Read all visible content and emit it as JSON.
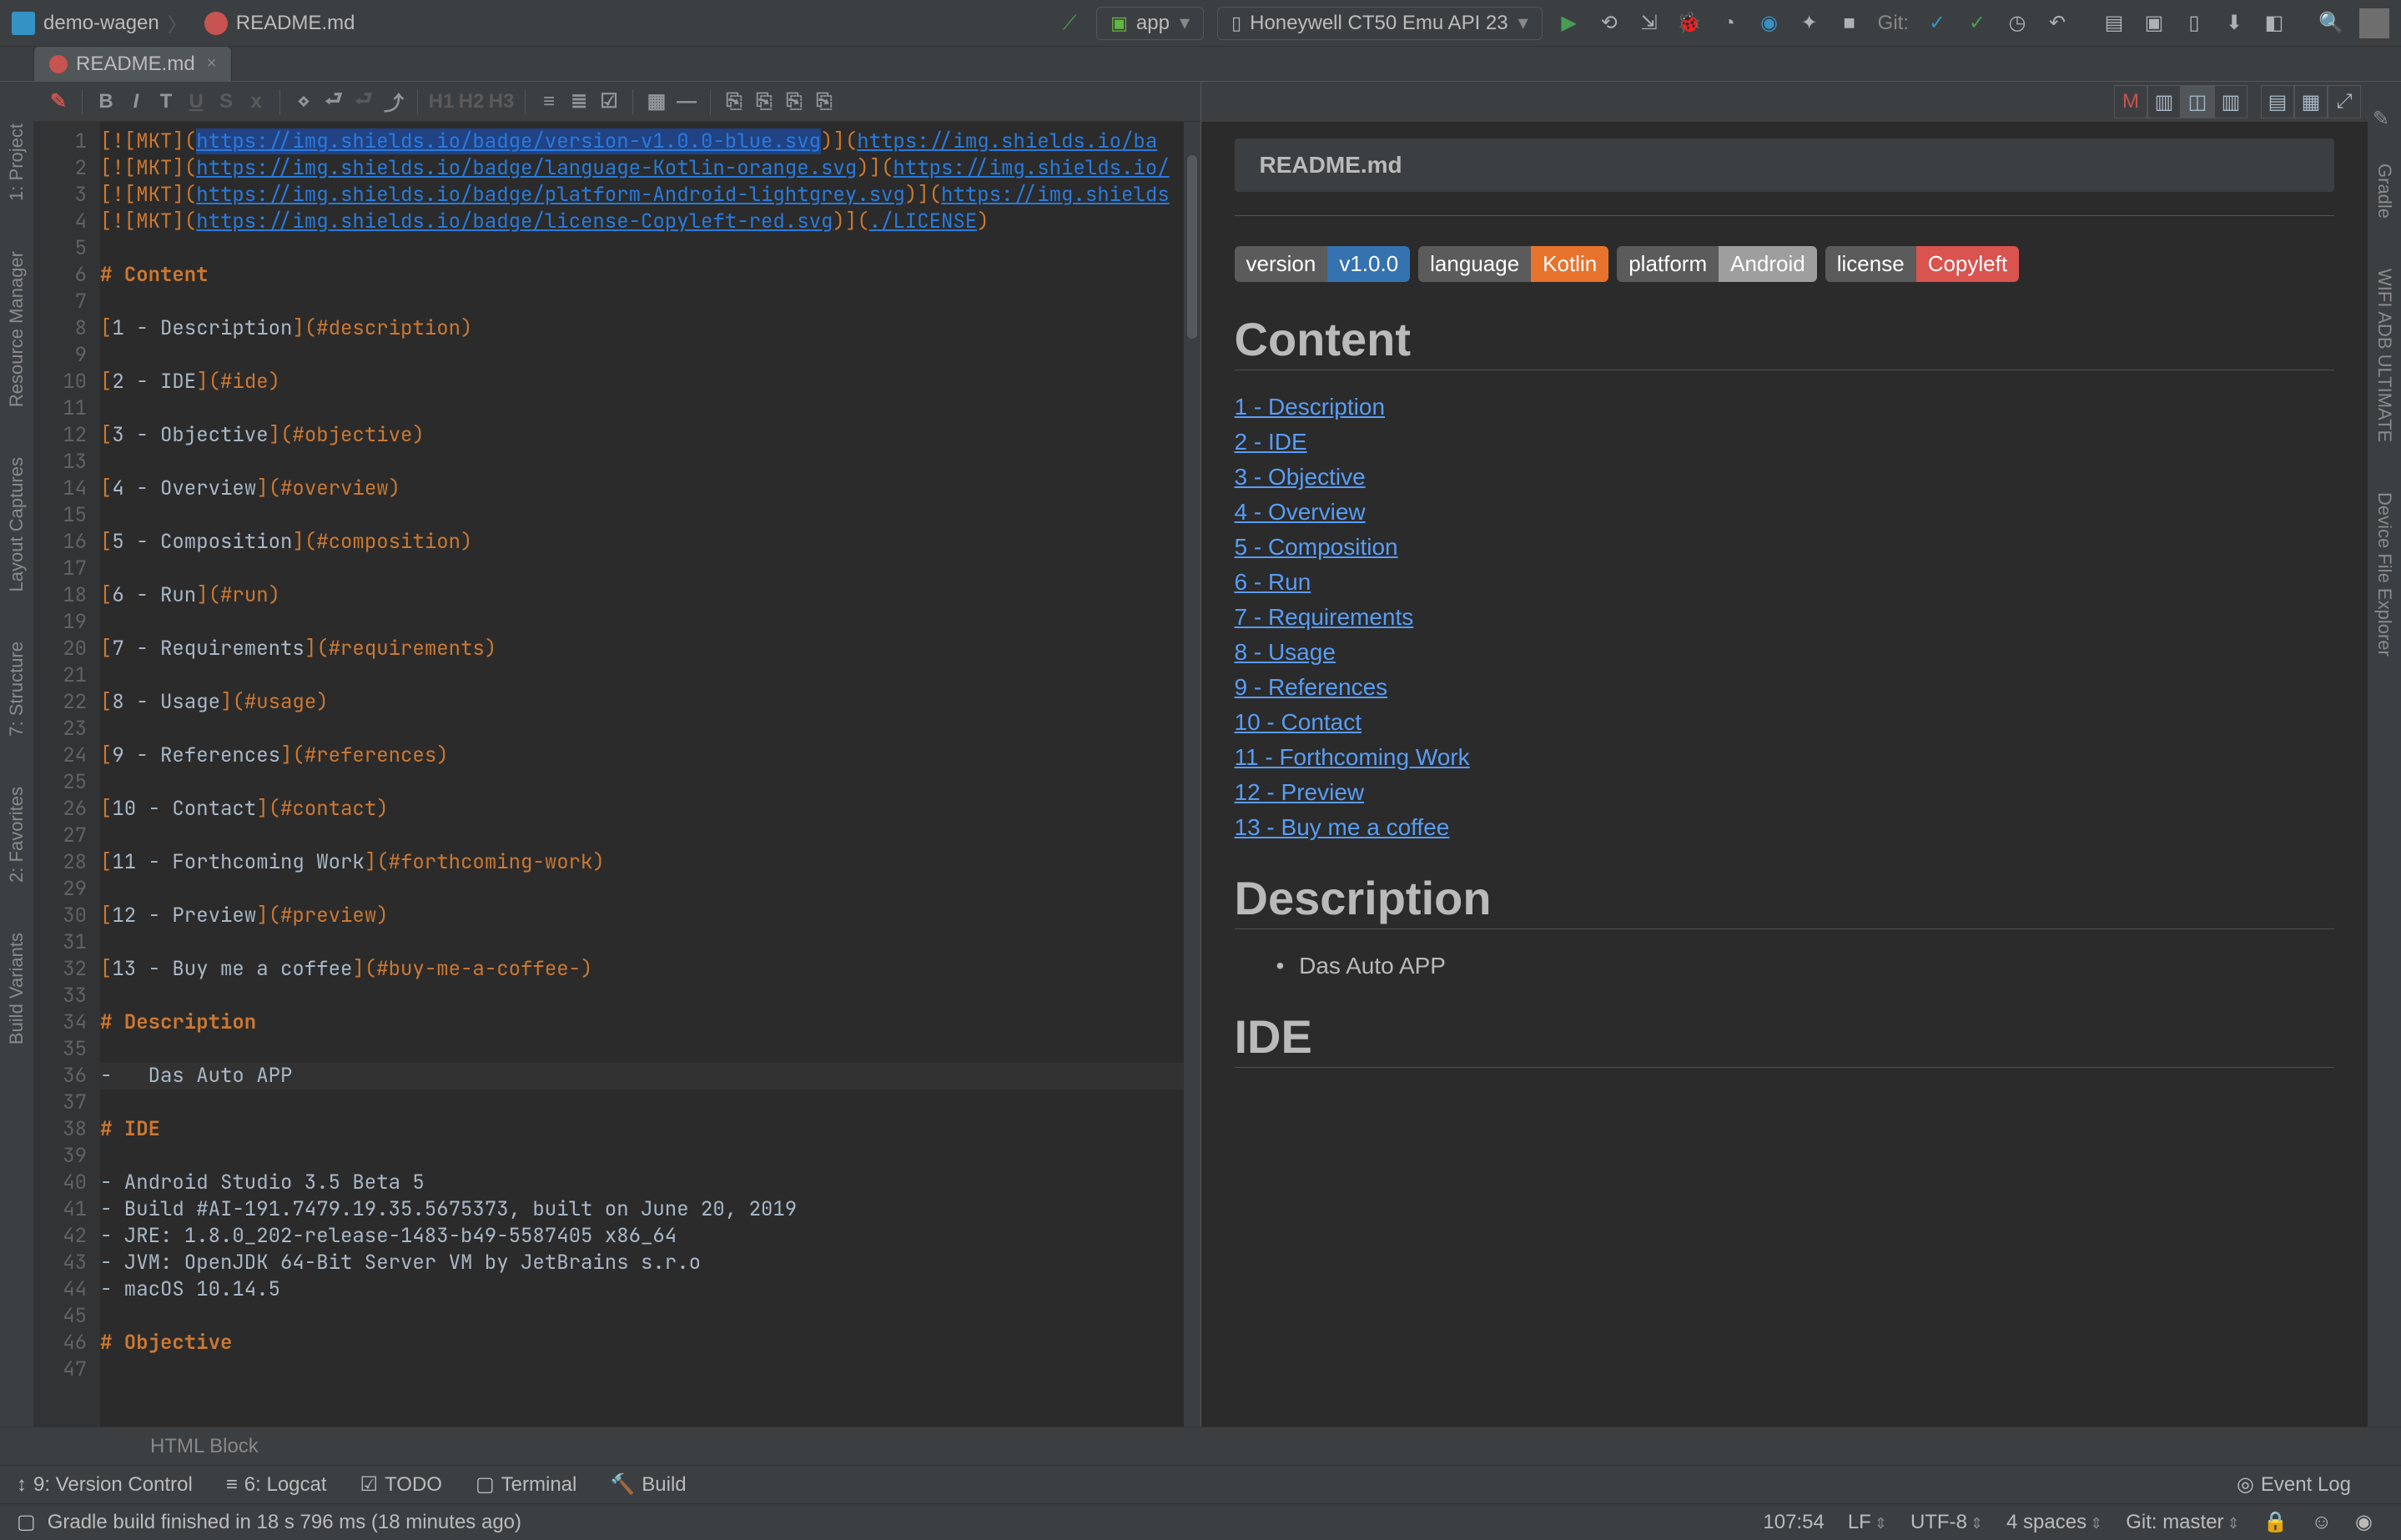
{
  "nav": {
    "project": "demo-wagen",
    "file": "README.md",
    "run_config": "app",
    "device": "Honeywell CT50 Emu API 23",
    "git_label": "Git:"
  },
  "tab": {
    "name": "README.md"
  },
  "sidebars_left": [
    "1: Project",
    "Resource Manager",
    "Layout Captures",
    "7: Structure",
    "2: Favorites",
    "Build Variants"
  ],
  "sidebars_right": [
    "Gradle",
    "WIFI ADB ULTIMATE",
    "Device File Explorer"
  ],
  "editor": {
    "crumb": "HTML Block",
    "lines": [
      {
        "n": 1,
        "segments": [
          {
            "t": "[![MKT](",
            "c": "br-punct"
          },
          {
            "t": "https://img.shields.io/badge/version-v1.0.0-blue.svg",
            "c": "link hl-sel"
          },
          {
            "t": ")](",
            "c": "br-punct"
          },
          {
            "t": "https://img.shields.io/ba",
            "c": "link"
          }
        ]
      },
      {
        "n": 2,
        "segments": [
          {
            "t": "[![MKT](",
            "c": "br-punct"
          },
          {
            "t": "https://img.shields.io/badge/language-Kotlin-orange.svg",
            "c": "link"
          },
          {
            "t": ")](",
            "c": "br-punct"
          },
          {
            "t": "https://img.shields.io/",
            "c": "link"
          }
        ]
      },
      {
        "n": 3,
        "segments": [
          {
            "t": "[![MKT](",
            "c": "br-punct"
          },
          {
            "t": "https://img.shields.io/badge/platform-Android-lightgrey.svg",
            "c": "link"
          },
          {
            "t": ")](",
            "c": "br-punct"
          },
          {
            "t": "https://img.shields",
            "c": "link"
          }
        ]
      },
      {
        "n": 4,
        "segments": [
          {
            "t": "[![MKT](",
            "c": "br-punct"
          },
          {
            "t": "https://img.shields.io/badge/license-Copyleft-red.svg",
            "c": "link"
          },
          {
            "t": ")](",
            "c": "br-punct"
          },
          {
            "t": "./LICENSE",
            "c": "link"
          },
          {
            "t": ")",
            "c": "br-punct"
          }
        ]
      },
      {
        "n": 5,
        "segments": []
      },
      {
        "n": 6,
        "segments": [
          {
            "t": "# Content",
            "c": "head"
          }
        ]
      },
      {
        "n": 7,
        "segments": []
      },
      {
        "n": 8,
        "segments": [
          {
            "t": "[",
            "c": "br-punct"
          },
          {
            "t": "1 - Description",
            "c": "txt"
          },
          {
            "t": "](",
            "c": "br-punct"
          },
          {
            "t": "#description",
            "c": "anchor"
          },
          {
            "t": ")",
            "c": "br-punct"
          }
        ]
      },
      {
        "n": 9,
        "segments": []
      },
      {
        "n": 10,
        "segments": [
          {
            "t": "[",
            "c": "br-punct"
          },
          {
            "t": "2 - IDE",
            "c": "txt"
          },
          {
            "t": "](",
            "c": "br-punct"
          },
          {
            "t": "#ide",
            "c": "anchor"
          },
          {
            "t": ")",
            "c": "br-punct"
          }
        ]
      },
      {
        "n": 11,
        "segments": []
      },
      {
        "n": 12,
        "segments": [
          {
            "t": "[",
            "c": "br-punct"
          },
          {
            "t": "3 - Objective",
            "c": "txt"
          },
          {
            "t": "](",
            "c": "br-punct"
          },
          {
            "t": "#objective",
            "c": "anchor"
          },
          {
            "t": ")",
            "c": "br-punct"
          }
        ]
      },
      {
        "n": 13,
        "segments": []
      },
      {
        "n": 14,
        "segments": [
          {
            "t": "[",
            "c": "br-punct"
          },
          {
            "t": "4 - Overview",
            "c": "txt"
          },
          {
            "t": "](",
            "c": "br-punct"
          },
          {
            "t": "#overview",
            "c": "anchor"
          },
          {
            "t": ")",
            "c": "br-punct"
          }
        ]
      },
      {
        "n": 15,
        "segments": []
      },
      {
        "n": 16,
        "segments": [
          {
            "t": "[",
            "c": "br-punct"
          },
          {
            "t": "5 - Composition",
            "c": "txt"
          },
          {
            "t": "](",
            "c": "br-punct"
          },
          {
            "t": "#composition",
            "c": "anchor"
          },
          {
            "t": ")",
            "c": "br-punct"
          }
        ]
      },
      {
        "n": 17,
        "segments": []
      },
      {
        "n": 18,
        "segments": [
          {
            "t": "[",
            "c": "br-punct"
          },
          {
            "t": "6 - Run",
            "c": "txt"
          },
          {
            "t": "](",
            "c": "br-punct"
          },
          {
            "t": "#run",
            "c": "anchor"
          },
          {
            "t": ")",
            "c": "br-punct"
          }
        ]
      },
      {
        "n": 19,
        "segments": []
      },
      {
        "n": 20,
        "segments": [
          {
            "t": "[",
            "c": "br-punct"
          },
          {
            "t": "7 - Requirements",
            "c": "txt"
          },
          {
            "t": "](",
            "c": "br-punct"
          },
          {
            "t": "#requirements",
            "c": "anchor"
          },
          {
            "t": ")",
            "c": "br-punct"
          }
        ]
      },
      {
        "n": 21,
        "segments": []
      },
      {
        "n": 22,
        "segments": [
          {
            "t": "[",
            "c": "br-punct"
          },
          {
            "t": "8 - Usage",
            "c": "txt"
          },
          {
            "t": "](",
            "c": "br-punct"
          },
          {
            "t": "#usage",
            "c": "anchor"
          },
          {
            "t": ")",
            "c": "br-punct"
          }
        ]
      },
      {
        "n": 23,
        "segments": []
      },
      {
        "n": 24,
        "segments": [
          {
            "t": "[",
            "c": "br-punct"
          },
          {
            "t": "9 - References",
            "c": "txt"
          },
          {
            "t": "](",
            "c": "br-punct"
          },
          {
            "t": "#references",
            "c": "anchor"
          },
          {
            "t": ")",
            "c": "br-punct"
          }
        ]
      },
      {
        "n": 25,
        "segments": []
      },
      {
        "n": 26,
        "segments": [
          {
            "t": "[",
            "c": "br-punct"
          },
          {
            "t": "10 - Contact",
            "c": "txt"
          },
          {
            "t": "](",
            "c": "br-punct"
          },
          {
            "t": "#contact",
            "c": "anchor"
          },
          {
            "t": ")",
            "c": "br-punct"
          }
        ]
      },
      {
        "n": 27,
        "segments": []
      },
      {
        "n": 28,
        "segments": [
          {
            "t": "[",
            "c": "br-punct"
          },
          {
            "t": "11 - Forthcoming Work",
            "c": "txt"
          },
          {
            "t": "](",
            "c": "br-punct"
          },
          {
            "t": "#forthcoming-work",
            "c": "anchor"
          },
          {
            "t": ")",
            "c": "br-punct"
          }
        ]
      },
      {
        "n": 29,
        "segments": []
      },
      {
        "n": 30,
        "segments": [
          {
            "t": "[",
            "c": "br-punct"
          },
          {
            "t": "12 - Preview",
            "c": "txt"
          },
          {
            "t": "](",
            "c": "br-punct"
          },
          {
            "t": "#preview",
            "c": "anchor"
          },
          {
            "t": ")",
            "c": "br-punct"
          }
        ]
      },
      {
        "n": 31,
        "segments": []
      },
      {
        "n": 32,
        "segments": [
          {
            "t": "[",
            "c": "br-punct"
          },
          {
            "t": "13 - Buy me a coffee",
            "c": "txt"
          },
          {
            "t": "](",
            "c": "br-punct"
          },
          {
            "t": "#buy-me-a-coffee-",
            "c": "anchor"
          },
          {
            "t": ")",
            "c": "br-punct"
          }
        ]
      },
      {
        "n": 33,
        "segments": []
      },
      {
        "n": 34,
        "segments": [
          {
            "t": "# Description",
            "c": "head"
          }
        ]
      },
      {
        "n": 35,
        "segments": []
      },
      {
        "n": 36,
        "segments": [
          {
            "t": "-   Das Auto APP",
            "c": "txt"
          }
        ]
      },
      {
        "n": 37,
        "segments": []
      },
      {
        "n": 38,
        "segments": [
          {
            "t": "# IDE",
            "c": "head"
          }
        ]
      },
      {
        "n": 39,
        "segments": []
      },
      {
        "n": 40,
        "segments": [
          {
            "t": "- Android Studio 3.5 Beta 5",
            "c": "txt"
          }
        ]
      },
      {
        "n": 41,
        "segments": [
          {
            "t": "- Build #AI-191.7479.19.35.5675373, built on June 20, 2019",
            "c": "txt"
          }
        ]
      },
      {
        "n": 42,
        "segments": [
          {
            "t": "- JRE: 1.8.0_202-release-1483-b49-5587405 x86_64",
            "c": "txt"
          }
        ]
      },
      {
        "n": 43,
        "segments": [
          {
            "t": "- JVM: OpenJDK 64-Bit Server VM by JetBrains s.r.o",
            "c": "txt"
          }
        ]
      },
      {
        "n": 44,
        "segments": [
          {
            "t": "- macOS 10.14.5",
            "c": "txt"
          }
        ]
      },
      {
        "n": 45,
        "segments": []
      },
      {
        "n": 46,
        "segments": [
          {
            "t": "# Objective",
            "c": "head"
          }
        ]
      },
      {
        "n": 47,
        "segments": []
      }
    ]
  },
  "preview": {
    "title": "README.md",
    "badges": [
      {
        "k": "version",
        "v": "v1.0.0",
        "color": "#3572b0"
      },
      {
        "k": "language",
        "v": "Kotlin",
        "color": "#e8732c"
      },
      {
        "k": "platform",
        "v": "Android",
        "color": "#9e9e9e"
      },
      {
        "k": "license",
        "v": "Copyleft",
        "color": "#d9534f"
      }
    ],
    "sections": [
      {
        "type": "h1",
        "text": "Content"
      },
      {
        "type": "link",
        "text": "1 - Description"
      },
      {
        "type": "link",
        "text": "2 - IDE"
      },
      {
        "type": "link",
        "text": "3 - Objective"
      },
      {
        "type": "link",
        "text": "4 - Overview"
      },
      {
        "type": "link",
        "text": "5 - Composition"
      },
      {
        "type": "link",
        "text": "6 - Run"
      },
      {
        "type": "link",
        "text": "7 - Requirements"
      },
      {
        "type": "link",
        "text": "8 - Usage"
      },
      {
        "type": "link",
        "text": "9 - References"
      },
      {
        "type": "link",
        "text": "10 - Contact"
      },
      {
        "type": "link",
        "text": "11 - Forthcoming Work"
      },
      {
        "type": "link",
        "text": "12 - Preview"
      },
      {
        "type": "link",
        "text": "13 - Buy me a coffee"
      },
      {
        "type": "h1",
        "text": "Description"
      },
      {
        "type": "li",
        "text": "Das Auto APP"
      },
      {
        "type": "h1",
        "text": "IDE"
      }
    ]
  },
  "bottom_tools": {
    "vc": "9: Version Control",
    "logcat": "6: Logcat",
    "todo": "TODO",
    "terminal": "Terminal",
    "build": "Build",
    "event_log": "Event Log"
  },
  "status": {
    "msg": "Gradle build finished in 18 s 796 ms (18 minutes ago)",
    "pos": "107:54",
    "le": "LF",
    "enc": "UTF-8",
    "indent": "4 spaces",
    "branch": "Git: master"
  }
}
